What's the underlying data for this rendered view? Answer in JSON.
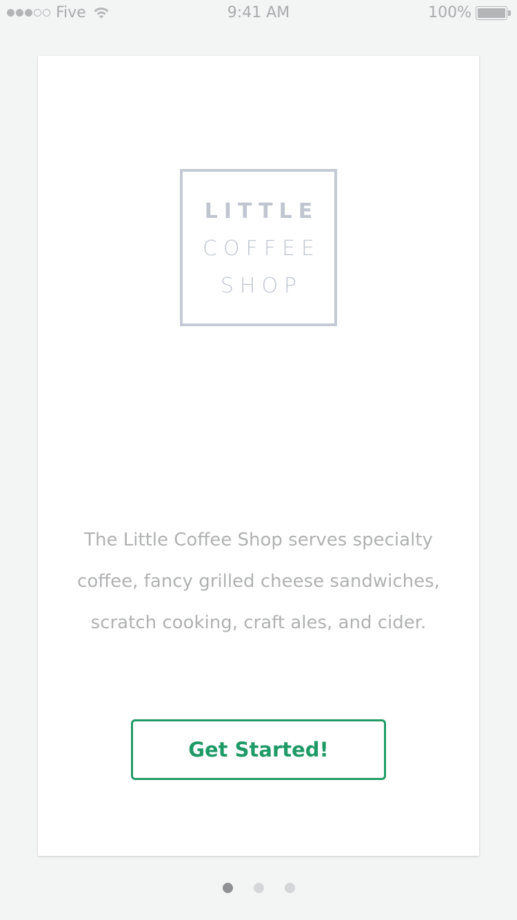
{
  "status_bar": {
    "carrier": "Five",
    "time": "9:41 AM",
    "battery": "100%",
    "signal_strength": 3,
    "signal_total": 5
  },
  "logo": {
    "line1": "LITTLE",
    "line2": "COFFEE",
    "line3": "SHOP"
  },
  "description": "The Little Coffee Shop serves specialty coffee, fancy grilled cheese sandwiches, scratch cooking, craft ales, and cider.",
  "cta_label": "Get Started!",
  "pager": {
    "current": 1,
    "total": 3
  },
  "colors": {
    "accent": "#1e9a67",
    "logo": "#c4c9d3",
    "text_muted": "#b0b1b2",
    "background": "#f3f4f4"
  }
}
